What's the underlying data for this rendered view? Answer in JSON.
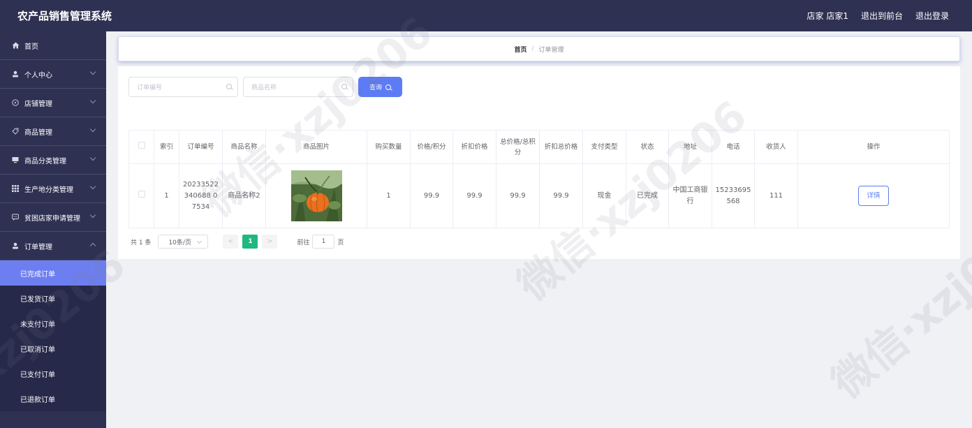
{
  "header": {
    "app_title": "农产品销售管理系统",
    "user_label": "店家 店家1",
    "front_link": "退出到前台",
    "logout_link": "退出登录"
  },
  "sidebar": {
    "items": [
      {
        "label": "首页",
        "icon": "home-icon",
        "has_children": false
      },
      {
        "label": "个人中心",
        "icon": "user-icon",
        "has_children": true
      },
      {
        "label": "店铺管理",
        "icon": "compass-icon",
        "has_children": true
      },
      {
        "label": "商品管理",
        "icon": "tag-icon",
        "has_children": true
      },
      {
        "label": "商品分类管理",
        "icon": "monitor-icon",
        "has_children": true
      },
      {
        "label": "生产地分类管理",
        "icon": "grid-icon",
        "has_children": true
      },
      {
        "label": "贫困店家申请管理",
        "icon": "message-icon",
        "has_children": true
      },
      {
        "label": "订单管理",
        "icon": "user-icon",
        "has_children": true,
        "expanded": true
      }
    ],
    "subitems": [
      {
        "label": "已完成订单",
        "active": true
      },
      {
        "label": "已发货订单"
      },
      {
        "label": "未支付订单"
      },
      {
        "label": "已取消订单"
      },
      {
        "label": "已支付订单"
      },
      {
        "label": "已退款订单"
      }
    ]
  },
  "breadcrumb": {
    "home": "首页",
    "separator": "/",
    "current": "订单管理"
  },
  "search": {
    "order_no_placeholder": "订单编号",
    "product_name_placeholder": "商品名称",
    "query_label": "查询"
  },
  "table": {
    "headers": [
      "索引",
      "订单编号",
      "商品名称",
      "商品图片",
      "购买数量",
      "价格/积分",
      "折扣价格",
      "总价格/总积分",
      "折扣总价格",
      "支付类型",
      "状态",
      "地址",
      "电话",
      "收货人",
      "操作"
    ],
    "rows": [
      {
        "index": "1",
        "order_no": "20233522340688 07534",
        "product_name": "商品名称2",
        "quantity": "1",
        "price": "99.9",
        "discount_price": "99.9",
        "total_price": "99.9",
        "discount_total": "99.9",
        "pay_type": "现金",
        "status": "已完成",
        "address": "中国工商银行",
        "phone": "15233695568",
        "receiver": "111",
        "action_label": "详情"
      }
    ]
  },
  "pagination": {
    "total": "共 1 条",
    "page_size": "10条/页",
    "prev": "<",
    "current_page": "1",
    "next": ">",
    "goto_label": "前往",
    "goto_value": "1",
    "page_suffix": "页"
  },
  "colors": {
    "sidebar_bg": "#2f3153",
    "accent": "#5b7cf5",
    "active_submenu": "#6d7ff0",
    "page_active": "#1fb87f"
  }
}
